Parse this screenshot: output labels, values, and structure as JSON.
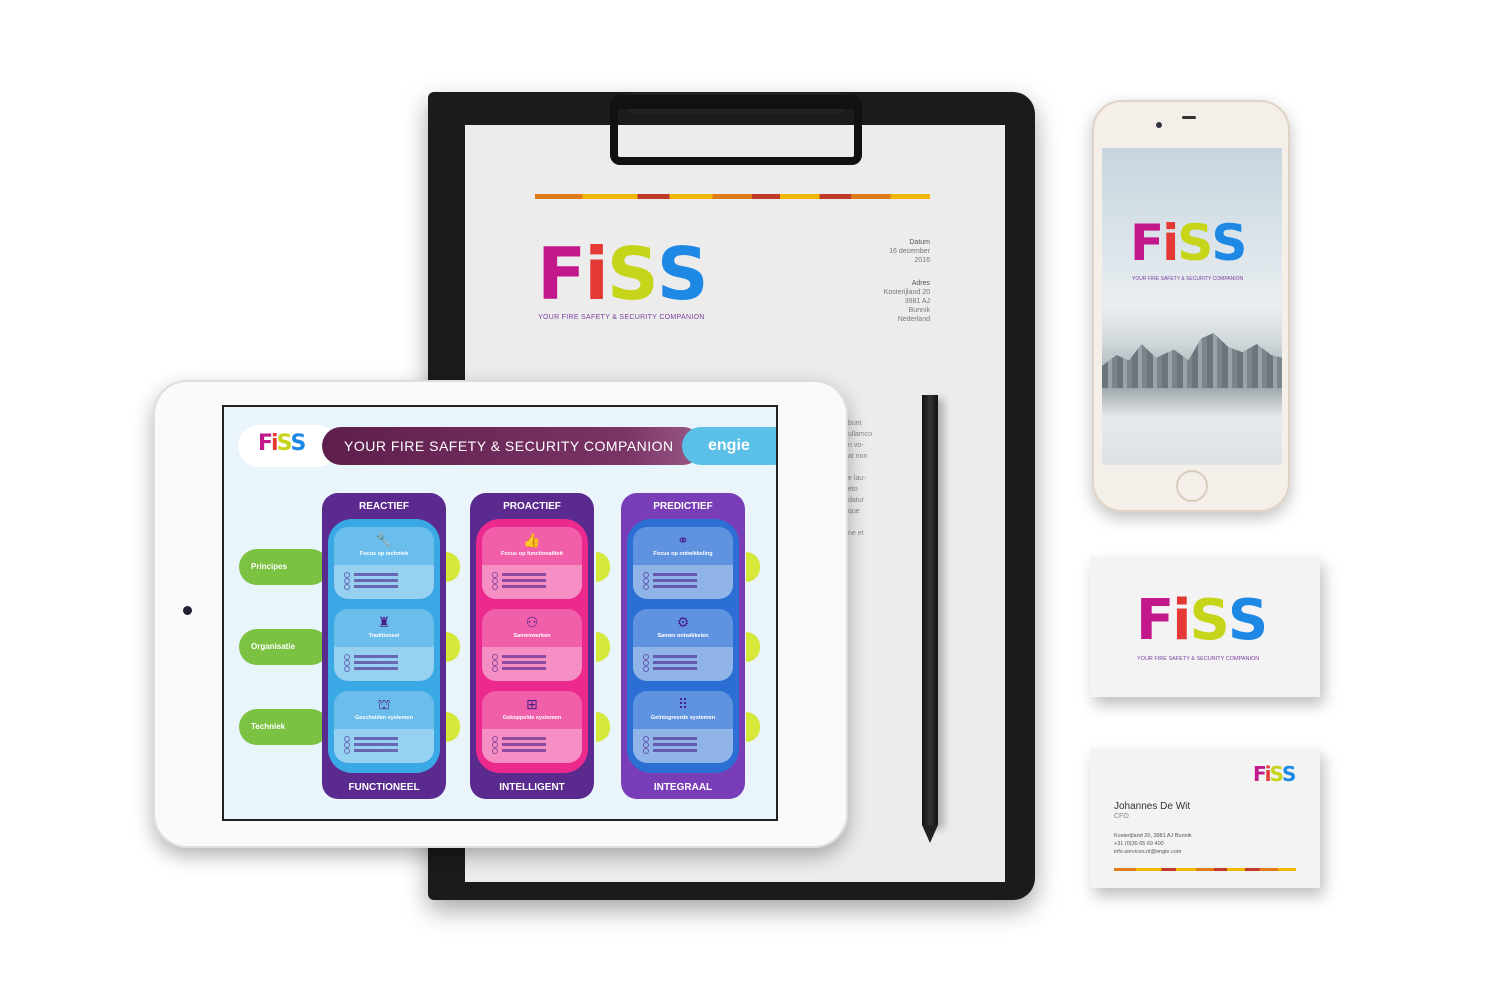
{
  "brand": {
    "logo_letters": [
      "F",
      "i",
      "S",
      "S"
    ],
    "tagline": "YOUR FIRE SAFETY & SECURITY COMPANION",
    "colors": [
      "#c2188b",
      "#e53935",
      "#c6d41a",
      "#1e88e5"
    ]
  },
  "letter": {
    "date_label": "Datum",
    "date_value": "16 december 2016",
    "address_label": "Adres",
    "address_lines": [
      "Kosterijland 20",
      "3981 AJ",
      "Bunnik",
      "Nederland"
    ],
    "body_fragments": [
      "bunt",
      "ullamco",
      "n vo-",
      "at non",
      "e lau-",
      "eto",
      "datur",
      "que",
      "ne et"
    ]
  },
  "tablet": {
    "header_title": "YOUR FIRE SAFETY & SECURITY COMPANION",
    "partner_logo": "engie",
    "row_labels": [
      "Principes",
      "Organisatie",
      "Techniek"
    ],
    "columns": [
      {
        "title": "REACTIEF",
        "footer": "FUNCTIONEEL",
        "outer": "#5b2a8e",
        "inner": "#3aa8e4",
        "cards": [
          {
            "icon": "wrench-icon",
            "glyph": "🔧",
            "title": "Focus op techniek"
          },
          {
            "icon": "worker-icon",
            "glyph": "♜",
            "title": "Traditioneel"
          },
          {
            "icon": "blocks-icon",
            "glyph": "⛫",
            "title": "Gescheiden systemen"
          }
        ]
      },
      {
        "title": "PROACTIEF",
        "footer": "INTELLIGENT",
        "outer": "#5b2a8e",
        "inner": "#ec2a8e",
        "cards": [
          {
            "icon": "thumbs-up-icon",
            "glyph": "👍",
            "title": "Focus op functionaliteit"
          },
          {
            "icon": "team-icon",
            "glyph": "⚇",
            "title": "Samenwerken"
          },
          {
            "icon": "hierarchy-icon",
            "glyph": "⊞",
            "title": "Gekoppelde systemen"
          }
        ]
      },
      {
        "title": "PREDICTIEF",
        "footer": "INTEGRAAL",
        "outer": "#7a3db8",
        "inner": "#2b6fd4",
        "cards": [
          {
            "icon": "binoculars-icon",
            "glyph": "⚭",
            "title": "Focus op ontwikkeling"
          },
          {
            "icon": "network-icon",
            "glyph": "⚙",
            "title": "Samen ontwikkelen"
          },
          {
            "icon": "grid-icon",
            "glyph": "⠿",
            "title": "Geïntegreerde systemen"
          }
        ]
      }
    ]
  },
  "business_card": {
    "name": "Johannes De Wit",
    "role": "CFO",
    "address": "Kosterijland 20, 3981 AJ Bunnik",
    "phone": "+31 (0)30 65 69 400",
    "email": "info.services.nl@engie.com"
  }
}
